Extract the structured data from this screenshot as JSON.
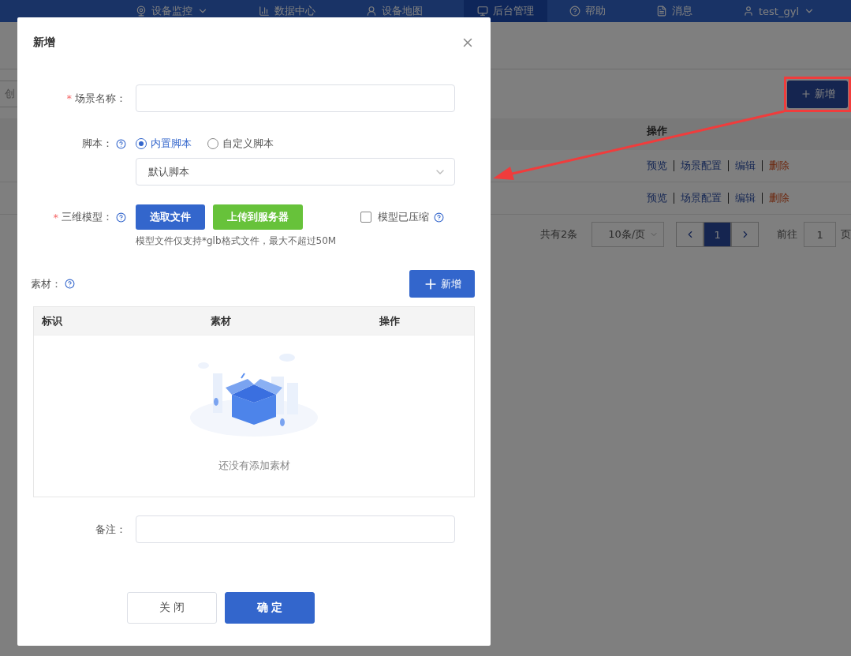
{
  "nav": {
    "items": [
      {
        "label": "设备监控",
        "selected": false,
        "dropdown": true
      },
      {
        "label": "数据中心",
        "selected": false,
        "dropdown": false
      },
      {
        "label": "设备地图",
        "selected": false,
        "dropdown": false
      },
      {
        "label": "后台管理",
        "selected": true,
        "dropdown": false
      },
      {
        "label": "帮助",
        "selected": false,
        "dropdown": false
      },
      {
        "label": "消息",
        "selected": false,
        "dropdown": false
      },
      {
        "label": "test_gyl",
        "selected": false,
        "dropdown": true
      }
    ]
  },
  "toolbar": {
    "search_text": "创",
    "add_button": "新增"
  },
  "table": {
    "columns": [
      "操作"
    ],
    "rows": [
      {
        "actions": [
          {
            "label": "预览",
            "kind": "link"
          },
          {
            "label": "场景配置",
            "kind": "link"
          },
          {
            "label": "编辑",
            "kind": "link"
          },
          {
            "label": "删除",
            "kind": "danger"
          }
        ]
      },
      {
        "actions": [
          {
            "label": "预览",
            "kind": "link"
          },
          {
            "label": "场景配置",
            "kind": "link"
          },
          {
            "label": "编辑",
            "kind": "link"
          },
          {
            "label": "删除",
            "kind": "danger"
          }
        ]
      }
    ]
  },
  "pagination": {
    "total": "共有2条",
    "page_size": "10条/页",
    "pages": [
      {
        "label": "1",
        "selected": true
      }
    ],
    "goto_label": "前往",
    "goto_value": "1",
    "page_suffix": "页"
  },
  "dialog": {
    "title": "新增",
    "scene_name": {
      "label": "场景名称：",
      "required_mark": "*"
    },
    "script": {
      "label": "脚本：",
      "options": [
        {
          "label": "内置脚本",
          "selected": true
        },
        {
          "label": "自定义脚本",
          "selected": false
        }
      ],
      "select_value": "默认脚本"
    },
    "model": {
      "label": "三维模型：",
      "required_mark": "*",
      "pick_button": "选取文件",
      "upload_button": "上传到服务器",
      "compressed": {
        "label": "模型已压缩",
        "checked": false
      },
      "hint": "模型文件仅支持*glb格式文件，最大不超过50M"
    },
    "materials": {
      "label": "素材：",
      "add_button": "新增",
      "columns": [
        "标识",
        "素材",
        "操作"
      ],
      "empty_text": "还没有添加素材"
    },
    "remark": {
      "label": "备注："
    },
    "buttons": [
      {
        "label": "关 闭",
        "kind": "default"
      },
      {
        "label": "确 定",
        "kind": "primary"
      }
    ]
  }
}
